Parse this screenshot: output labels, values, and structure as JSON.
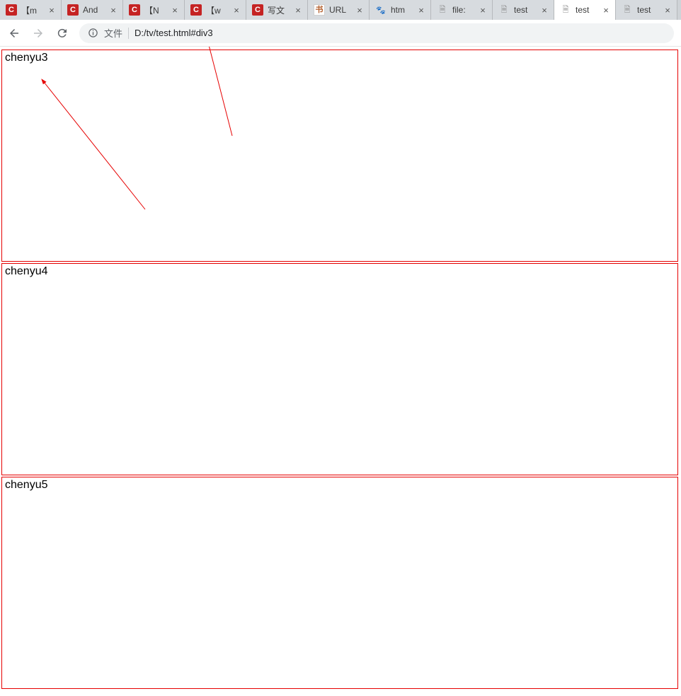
{
  "tabs": [
    {
      "favicon": "fav-c",
      "title": "【m"
    },
    {
      "favicon": "fav-c",
      "title": "And"
    },
    {
      "favicon": "fav-c",
      "title": "【N"
    },
    {
      "favicon": "fav-c",
      "title": "【w"
    },
    {
      "favicon": "fav-c",
      "title": "写文"
    },
    {
      "favicon": "fav-jian",
      "title": "URL"
    },
    {
      "favicon": "fav-paw",
      "title": "htm"
    },
    {
      "favicon": "fav-page",
      "title": "file:"
    },
    {
      "favicon": "fav-page",
      "title": "test"
    },
    {
      "favicon": "fav-page",
      "title": "test",
      "active": true
    },
    {
      "favicon": "fav-page",
      "title": "test"
    }
  ],
  "toolbar": {
    "file_label": "文件",
    "url": "D:/tv/test.html#div3"
  },
  "page": {
    "blocks": {
      "b3": "chenyu3",
      "b4": "chenyu4",
      "b5": "chenyu5"
    }
  },
  "favicon_glyphs": {
    "fav-c": "C",
    "fav-jian": "书",
    "fav-paw": "🐾",
    "fav-page": "🗎"
  }
}
